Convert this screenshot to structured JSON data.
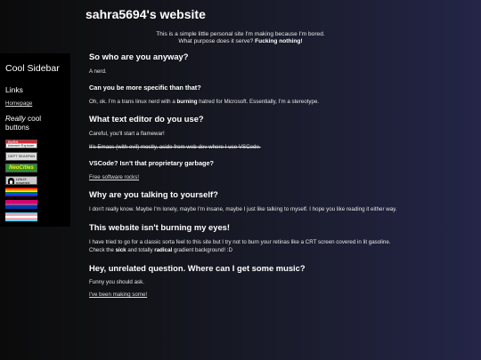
{
  "site": {
    "title": "sahra5694's website",
    "intro_line1": "This is a simple little personal site I'm making because I'm bored.",
    "intro_line2_pre": "What purpose does it serve? ",
    "intro_line2_bold": "Fucking nothing!"
  },
  "sidebar": {
    "title": "Cool Sidebar",
    "links_heading": "Links",
    "homepage": "Homepage",
    "cool_italic": "Really",
    "cool_rest": " cool",
    "cool_line2": "buttons",
    "badges": {
      "burn_line1": "BURN",
      "burn_line2": "Internet Explorer",
      "dept": "DEPT SEASPAN",
      "neo": "NeoCities",
      "linux_line1": "LINUX",
      "linux_line2": "powered"
    }
  },
  "main": {
    "h1": "So who are you anyway?",
    "p1": "A nerd.",
    "h1b": "Can you be more specific than that?",
    "p2_pre": "Oh, ok. I'm a trans linux nerd with a ",
    "p2_bold": "burning",
    "p2_post": " hatred for Microsoft. Essentially, I'm a stereotype.",
    "h2": "What text editor do you use?",
    "p3": "Careful, you'll start a flamewar!",
    "p4": "It's Emacs (with evil) mostly, aside from web dev where I use VSCode.",
    "h2b": "VSCode? Isn't that proprietary garbage?",
    "p5": "Free software rocks!",
    "h3": "Why are you talking to yourself?",
    "p6": "I don't really know. Maybe I'm lonely, maybe I'm insane, maybe I just like talking to myself. I hope you like reading it either way.",
    "h4": "This website isn't burning my eyes!",
    "p7": "I have tried to go for a classic sorta feel to this site but I try not to burn your retinas like a CRT screen covered in lit gasoline.",
    "p8_pre": "Check the ",
    "p8_b1": "sick",
    "p8_mid": " and totally ",
    "p8_b2": "radical",
    "p8_post": " gradient background! :D",
    "h5": "Hey, unrelated question. Where can I get some music?",
    "p9": "Funny you should ask.",
    "p10": "I've been making some!"
  }
}
